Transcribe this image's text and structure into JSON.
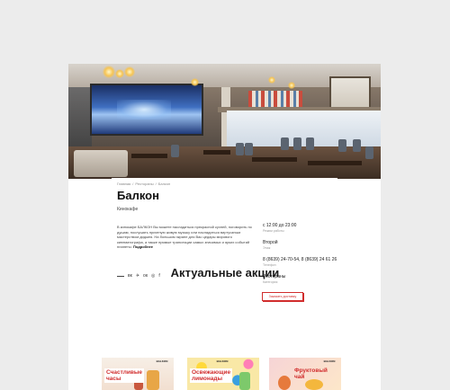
{
  "breadcrumbs": [
    "Главная",
    "Рестораны",
    "Балкон"
  ],
  "venue": {
    "name": "Балкон",
    "type": "Кинокафе",
    "description": "В кинокафе БАЛКОН Вы можете насладиться прекрасной кухней, поговорить по душам, послушать приятную живую музыку или насладиться виртуозным мастерством диджея. На большом экране для Вас цедары мирового кинематографа, а также прямые трансляции самых значимых и ярких событий планеты.",
    "more_link": "Подробнее"
  },
  "info": {
    "hours": {
      "value": "с 12:00 до 23:00",
      "label": "Режим работы"
    },
    "floor": {
      "value": "Второй",
      "label": "Этаж"
    },
    "phone": {
      "value": "8 (8639) 24-70-54, 8 (8639) 24 61 26",
      "label": "Телефон"
    },
    "category": {
      "value": "Рестораны",
      "label": "Категория"
    }
  },
  "book_button": "Заказать доставку",
  "socials": [
    "vk-icon",
    "telegram-icon",
    "odnoklassniki-icon",
    "instagram-icon",
    "facebook-icon"
  ],
  "social_glyphs": [
    "вк",
    "✈",
    "ок",
    "◎",
    "f"
  ],
  "section_title": "Актуальные акции",
  "promos": [
    {
      "label_line1": "Счастливые",
      "label_line2": "часы",
      "logo": "BALKON"
    },
    {
      "label_line1": "Освежающие",
      "label_line2": "лимонады",
      "logo": "BALKON"
    },
    {
      "label_line1": "Фруктовый",
      "label_line2": "чай",
      "logo": "BALKON"
    }
  ],
  "colors": {
    "accent": "#d12d2d",
    "background": "#ececec"
  }
}
